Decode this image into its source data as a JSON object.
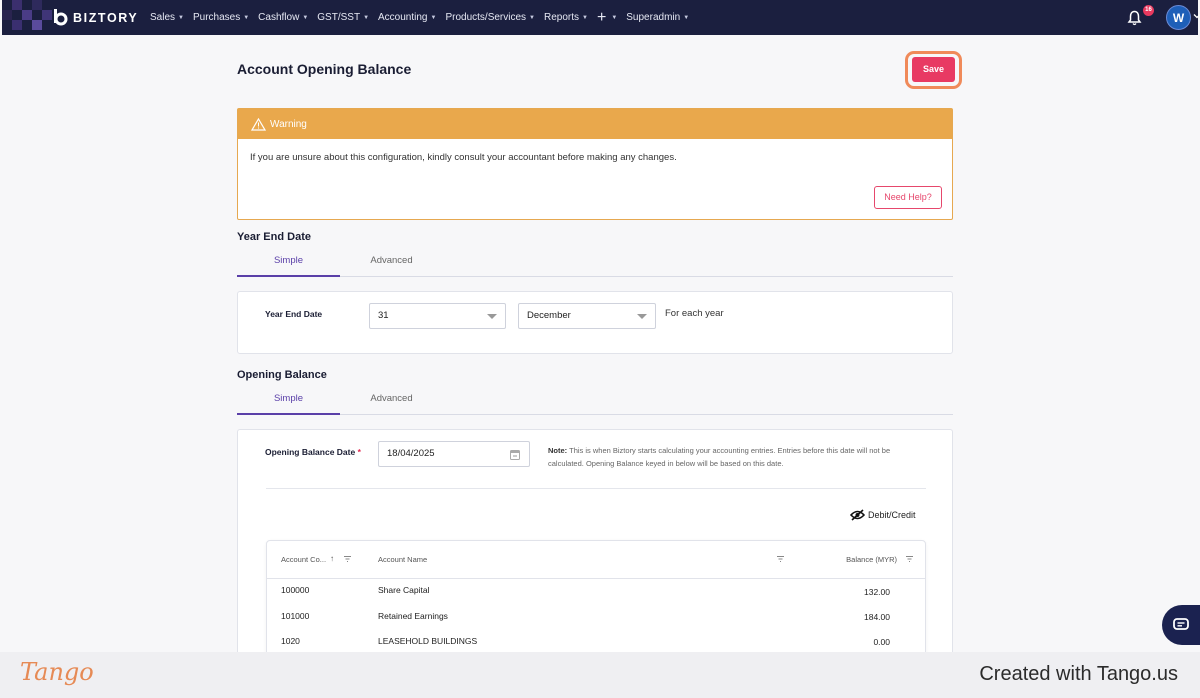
{
  "brand": {
    "name": "BIZTORY"
  },
  "nav": {
    "items": [
      {
        "label": "Sales"
      },
      {
        "label": "Purchases"
      },
      {
        "label": "Cashflow"
      },
      {
        "label": "GST/SST"
      },
      {
        "label": "Accounting"
      },
      {
        "label": "Products/Services"
      },
      {
        "label": "Reports"
      },
      {
        "label": "+"
      },
      {
        "label": "Superadmin"
      }
    ],
    "notification_count": "16",
    "avatar_initial": "W"
  },
  "page": {
    "title": "Account Opening Balance",
    "save_label": "Save"
  },
  "warning": {
    "title": "Warning",
    "text": "If you are unsure about this configuration, kindly consult your accountant before making any changes.",
    "help_label": "Need Help?"
  },
  "year_end": {
    "section_title": "Year End Date",
    "tabs": [
      "Simple",
      "Advanced"
    ],
    "field_label": "Year End Date",
    "day_value": "31",
    "month_value": "December",
    "suffix": "For each year"
  },
  "opening_balance": {
    "section_title": "Opening Balance",
    "tabs": [
      "Simple",
      "Advanced"
    ],
    "date_label": "Opening Balance Date",
    "required_mark": "*",
    "date_value": "18/04/2025",
    "note_bold": "Note:",
    "note_text": "This is when Biztory starts calculating your accounting entries. Entries before this date will not be calculated. Opening Balance keyed in below will be based on this date.",
    "toggle_label": "Debit/Credit",
    "table": {
      "headers": [
        "Account Co...",
        "Account Name",
        "Balance (MYR)"
      ],
      "rows": [
        {
          "code": "100000",
          "name": "Share Capital",
          "balance": "132.00"
        },
        {
          "code": "101000",
          "name": "Retained Earnings",
          "balance": "184.00"
        },
        {
          "code": "1020",
          "name": "LEASEHOLD BUILDINGS",
          "balance": "0.00"
        }
      ]
    }
  },
  "footer": {
    "logo": "Tango",
    "credit": "Created with Tango.us"
  },
  "colors": {
    "navbar": "#1b1f3f",
    "accent": "#e83a63",
    "warning": "#e9a84c",
    "tab_active": "#5a3fa8"
  }
}
